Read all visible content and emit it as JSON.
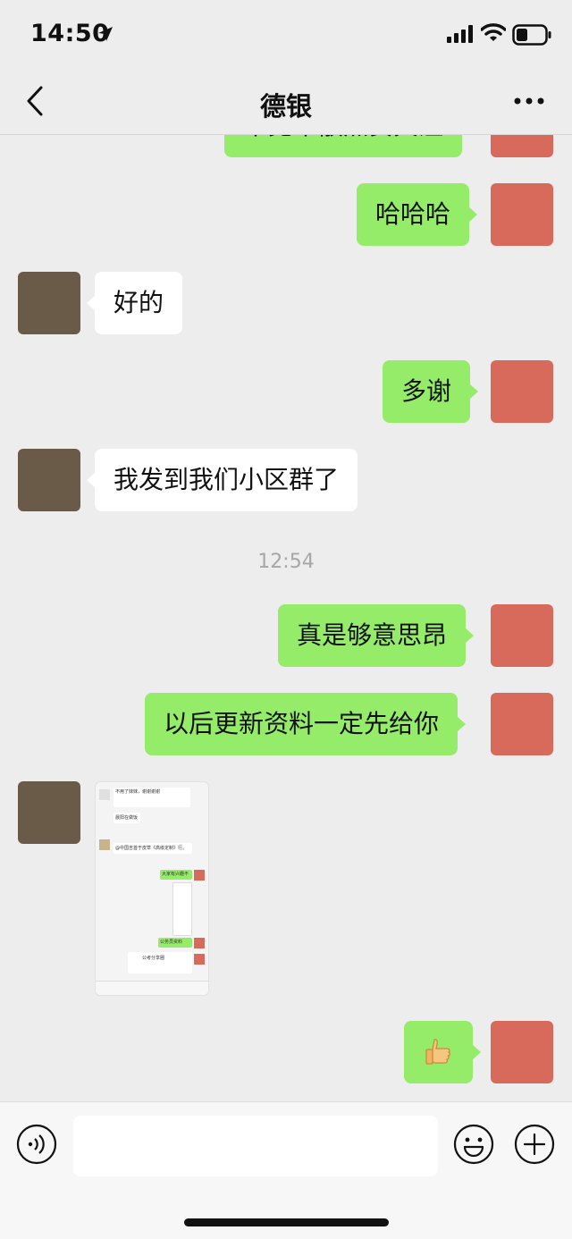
{
  "status_bar": {
    "time": "14:50"
  },
  "nav": {
    "title": "德银"
  },
  "messages": [
    {
      "side": "sent",
      "text": "不见不散点赞关注"
    },
    {
      "side": "sent",
      "text": "哈哈哈"
    },
    {
      "side": "received",
      "text": "好的"
    },
    {
      "side": "sent",
      "text": "多谢"
    },
    {
      "side": "received",
      "text": "我发到我们小区群了"
    },
    {
      "side": "sent",
      "text": "真是够意思昂"
    },
    {
      "side": "sent",
      "text": "以后更新资料一定先给你"
    },
    {
      "side": "received",
      "type": "image"
    },
    {
      "side": "sent",
      "type": "sticker",
      "icon": "thumbs-up-emoji"
    }
  ],
  "timestamp": "12:54",
  "shared_screenshot": {
    "lines": [
      "不用了妹妹，谢谢谢谢",
      "晨阳在做饭",
      "@中国吉首于皮草《高级定制》行。",
      "大家有兴趣不",
      "公务员资料",
      "公考分享圈"
    ]
  },
  "input": {
    "value": ""
  },
  "colors": {
    "sent_bubble": "#95ec69",
    "received_bubble": "#ffffff",
    "background": "#ededed",
    "timestamp": "#a7a7a7"
  }
}
